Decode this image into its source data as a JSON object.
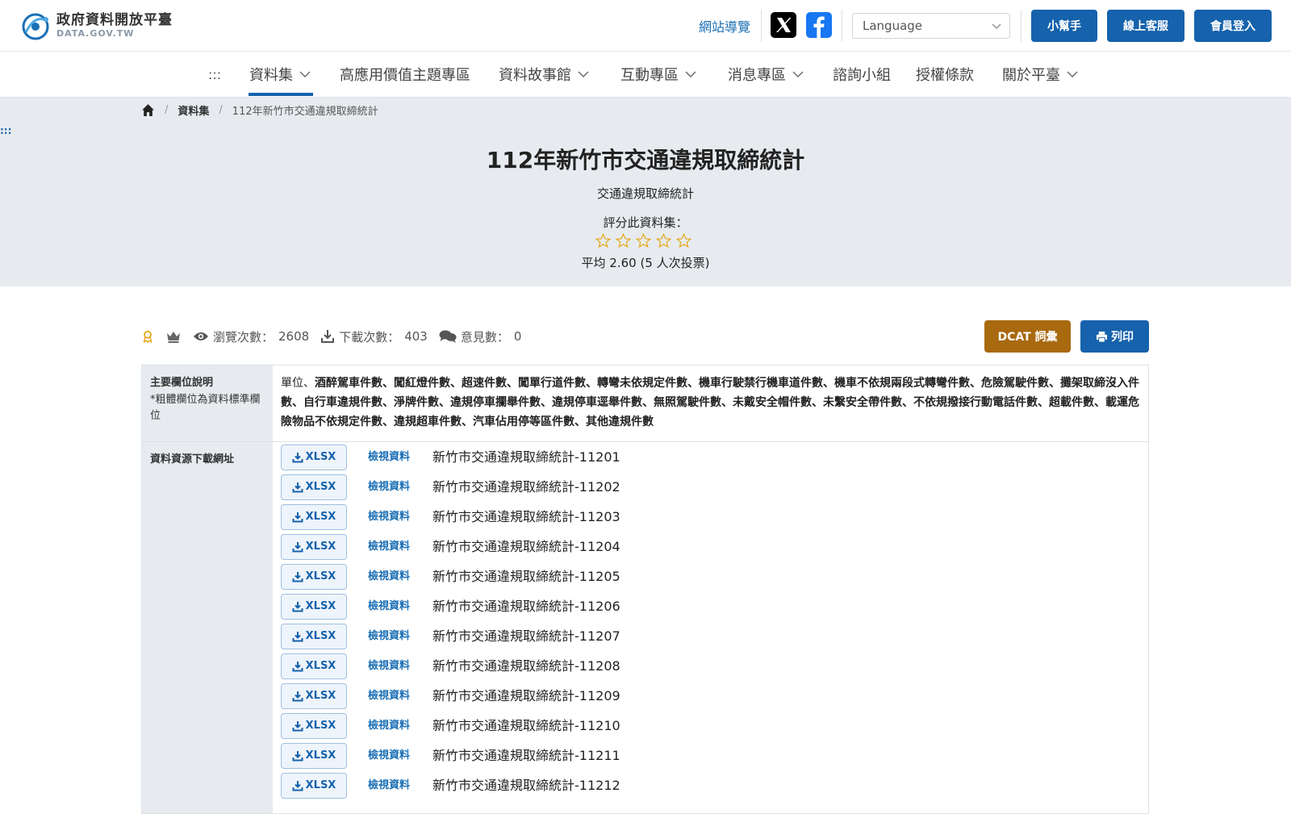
{
  "header": {
    "logo_title": "政府資料開放平臺",
    "logo_sub": "DATA.GOV.TW",
    "sitemap": "網站導覽",
    "language_placeholder": "Language",
    "buttons": [
      "小幫手",
      "線上客服",
      "會員登入"
    ],
    "social": [
      "x-icon",
      "facebook-icon"
    ]
  },
  "nav": {
    "skip": ":::",
    "items": [
      {
        "label": "資料集",
        "dropdown": true
      },
      {
        "label": "高應用價值主題專區",
        "dropdown": false
      },
      {
        "label": "資料故事館",
        "dropdown": true
      },
      {
        "label": "互動專區",
        "dropdown": true
      },
      {
        "label": "消息專區",
        "dropdown": true
      },
      {
        "label": "諮詢小組",
        "dropdown": false
      },
      {
        "label": "授權條款",
        "dropdown": false
      },
      {
        "label": "關於平臺",
        "dropdown": true
      }
    ]
  },
  "breadcrumb": {
    "items": [
      "資料集",
      "112年新竹市交通違規取締統計"
    ]
  },
  "hero": {
    "skip_mark": ":::",
    "title": "112年新竹市交通違規取締統計",
    "subtitle": "交通違規取締統計",
    "rate_label": "評分此資料集：",
    "stars_filled": 0,
    "stars_total": 5,
    "average": "平均 2.60 (5 人次投票)"
  },
  "stats": {
    "views_label": "瀏覽次數：",
    "views": "2608",
    "downloads_label": "下載次數：",
    "downloads": "403",
    "comments_label": "意見數：",
    "comments": "0",
    "dcat_button": "DCAT 詞彙",
    "print_button": "列印"
  },
  "table": {
    "fields_head": "主要欄位說明",
    "fields_note": "*粗體欄位為資料標準欄位",
    "fields_plain": "單位、",
    "fields_bold": "酒醉駕車件數、闖紅燈件數、超速件數、闖單行道件數、轉彎未依規定件數、機車行駛禁行機車道件數、機車不依規兩段式轉彎件數、危險駕駛件數、攤架取締沒入件數、自行車違規件數、淨牌件數、違規停車攔舉件數、違規停車逕舉件數、無照駕駛件數、未戴安全帽件數、未繫安全帶件數、不依規撥接行動電話件數、超載件數、載運危險物品不依規定件數、違規超車件數、汽車佔用停等區件數、其他違規件數",
    "resources_head": "資料資源下載網址",
    "format_label": "XLSX",
    "view_label": "檢視資料",
    "resources": [
      "新竹市交通違規取締統計-11201",
      "新竹市交通違規取締統計-11202",
      "新竹市交通違規取締統計-11203",
      "新竹市交通違規取締統計-11204",
      "新竹市交通違規取締統計-11205",
      "新竹市交通違規取締統計-11206",
      "新竹市交通違規取締統計-11207",
      "新竹市交通違規取締統計-11208",
      "新竹市交通違規取締統計-11209",
      "新竹市交通違規取締統計-11210",
      "新竹市交通違規取締統計-11211",
      "新竹市交通違規取締統計-11212"
    ]
  },
  "colors": {
    "primary": "#1662ac",
    "dcat": "#a8690f",
    "hero_bg": "#e7ebef",
    "star": "#e6a817"
  }
}
